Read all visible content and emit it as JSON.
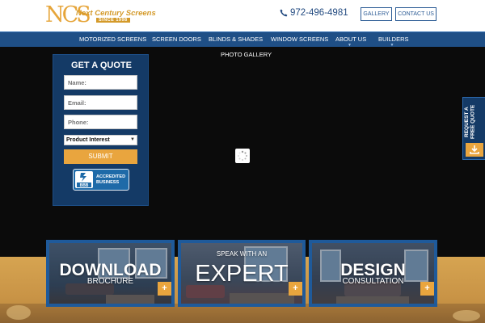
{
  "header": {
    "logo_mark": "NCS",
    "logo_name": "Next Century Screens",
    "logo_since": "SINCE 1998",
    "phone": "972-496-4981",
    "gallery_label": "GALLERY",
    "contact_label": "CONTACT US"
  },
  "nav": {
    "items": [
      {
        "label": "MOTORIZED SCREENS"
      },
      {
        "label": "SCREEN DOORS"
      },
      {
        "label": "BLINDS & SHADES"
      },
      {
        "label": "WINDOW SCREENS"
      },
      {
        "label": "ABOUT US"
      },
      {
        "label": "BUILDERS"
      }
    ],
    "second_row": "PHOTO GALLERY"
  },
  "quote": {
    "title": "GET A QUOTE",
    "name_placeholder": "Name:",
    "email_placeholder": "Email:",
    "phone_placeholder": "Phone:",
    "product_select": "Product Interest",
    "submit_label": "SUBMIT",
    "bbb_mark": "BBB",
    "bbb_line1": "ACCREDITED",
    "bbb_line2": "BUSINESS"
  },
  "request_tab": {
    "label": "REQUEST A FREE QUOTE"
  },
  "cards": [
    {
      "big": "DOWNLOAD",
      "small": "BROCHURE"
    },
    {
      "small": "SPEAK WITH AN",
      "big": "EXPERT"
    },
    {
      "big": "DESIGN",
      "small": "CONSULTATION"
    }
  ],
  "colors": {
    "brand_blue": "#1f4f86",
    "brand_orange": "#e9a53e",
    "dark_navy": "#143a66"
  }
}
